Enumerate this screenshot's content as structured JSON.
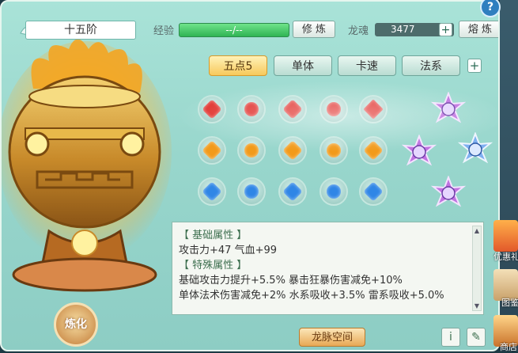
{
  "header": {
    "stage_label": "十五阶",
    "xp_label": "经验",
    "xp_value": "--/--",
    "xp_progress": 1.0,
    "refine_button": "修 炼",
    "soul_label": "龙魂",
    "soul_value": "3477",
    "smelt_button": "熔 炼"
  },
  "tabs": [
    {
      "label": "五点5",
      "active": true
    },
    {
      "label": "单体",
      "active": false
    },
    {
      "label": "卡速",
      "active": false
    },
    {
      "label": "法系",
      "active": false
    }
  ],
  "gem_rows": [
    {
      "color": "#e0302c",
      "count": 5
    },
    {
      "color": "#f29a1a",
      "count": 5
    },
    {
      "color": "#2f86e6",
      "count": 5
    }
  ],
  "star_gems": [
    {
      "name": "star-gem-top",
      "color": "#c072e0"
    },
    {
      "name": "star-gem-mid-left",
      "color": "#c072e0"
    },
    {
      "name": "star-gem-mid-right",
      "color": "#7fb0f0"
    },
    {
      "name": "star-gem-bottom",
      "color": "#c072e0"
    }
  ],
  "info": {
    "base_heading": "【 基础属性 】",
    "base_line": "攻击力+47  气血+99",
    "special_heading": "【 特殊属性 】",
    "special_line1": "基础攻击力提升+5.5%  暴击狂暴伤害减免+10%",
    "special_line2": "单体法术伤害减免+2%  水系吸收+3.5%  雷系吸收+5.0%"
  },
  "footer": {
    "meridian_button": "龙脉空间",
    "refine_circle": "炼化"
  },
  "side": {
    "item1": "优惠礼",
    "item2": "图鉴",
    "item3": "商店"
  },
  "colors": {
    "panel": "#a9e3d8",
    "xp_bar": "#2fb454",
    "active_tab": "#f7c95b"
  }
}
